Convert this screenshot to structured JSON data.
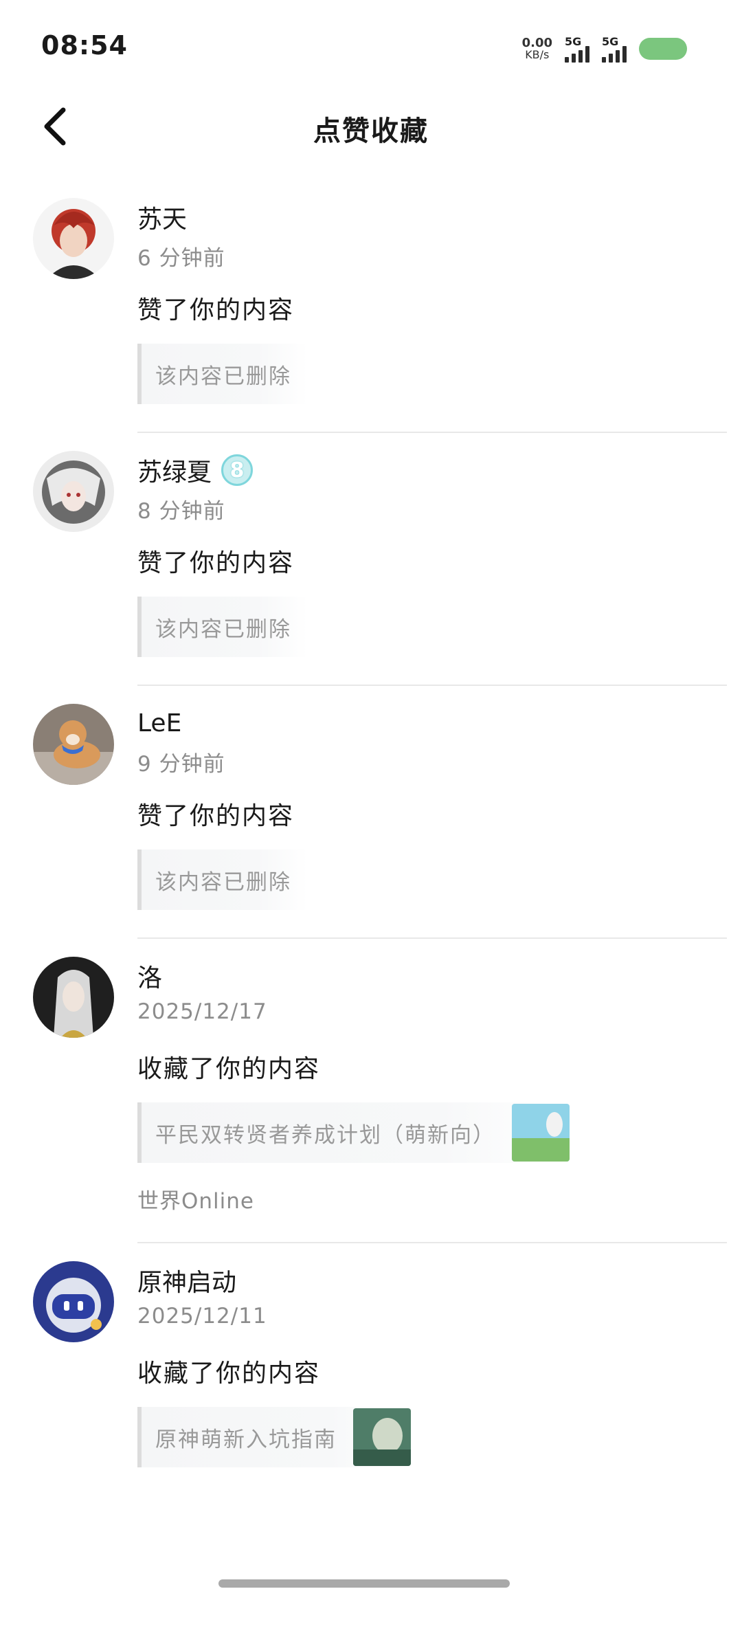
{
  "status_bar": {
    "time": "08:54",
    "net_speed_value": "0.00",
    "net_speed_unit": "KB/s",
    "signal_1_label": "5G",
    "signal_2_label": "5G",
    "battery_color": "#7bc67e"
  },
  "header": {
    "title": "点赞收藏",
    "back_icon": "chevron-left-icon"
  },
  "notifications": [
    {
      "name": "苏天",
      "time": "6 分钟前",
      "action": "赞了你的内容",
      "quote": "该内容已删除",
      "avatar_colors": [
        "#c0392b",
        "#2c2c2c"
      ]
    },
    {
      "name": "苏绿夏",
      "badge": "8",
      "time": "8 分钟前",
      "action": "赞了你的内容",
      "quote": "该内容已删除",
      "avatar_colors": [
        "#6b6b6b",
        "#e9e9e9"
      ]
    },
    {
      "name": "LeE",
      "time": "9 分钟前",
      "action": "赞了你的内容",
      "quote": "该内容已删除",
      "avatar_colors": [
        "#d99a5b",
        "#8a7f75"
      ]
    },
    {
      "name": "洛",
      "time": "2025/12/17",
      "action": "收藏了你的内容",
      "quote": "平民双转贤者养成计划（萌新向）",
      "thumb_colors": [
        "#8fd3e8",
        "#7fbf6a"
      ],
      "source": "世界Online",
      "avatar_colors": [
        "#1f1f1f",
        "#d8d8d8"
      ]
    },
    {
      "name": "原神启动",
      "time": "2025/12/11",
      "action": "收藏了你的内容",
      "quote": "原神萌新入坑指南",
      "thumb_colors": [
        "#4f7d68",
        "#cfd9c8"
      ],
      "avatar_colors": [
        "#2b3a8f",
        "#f2c14e"
      ]
    }
  ]
}
